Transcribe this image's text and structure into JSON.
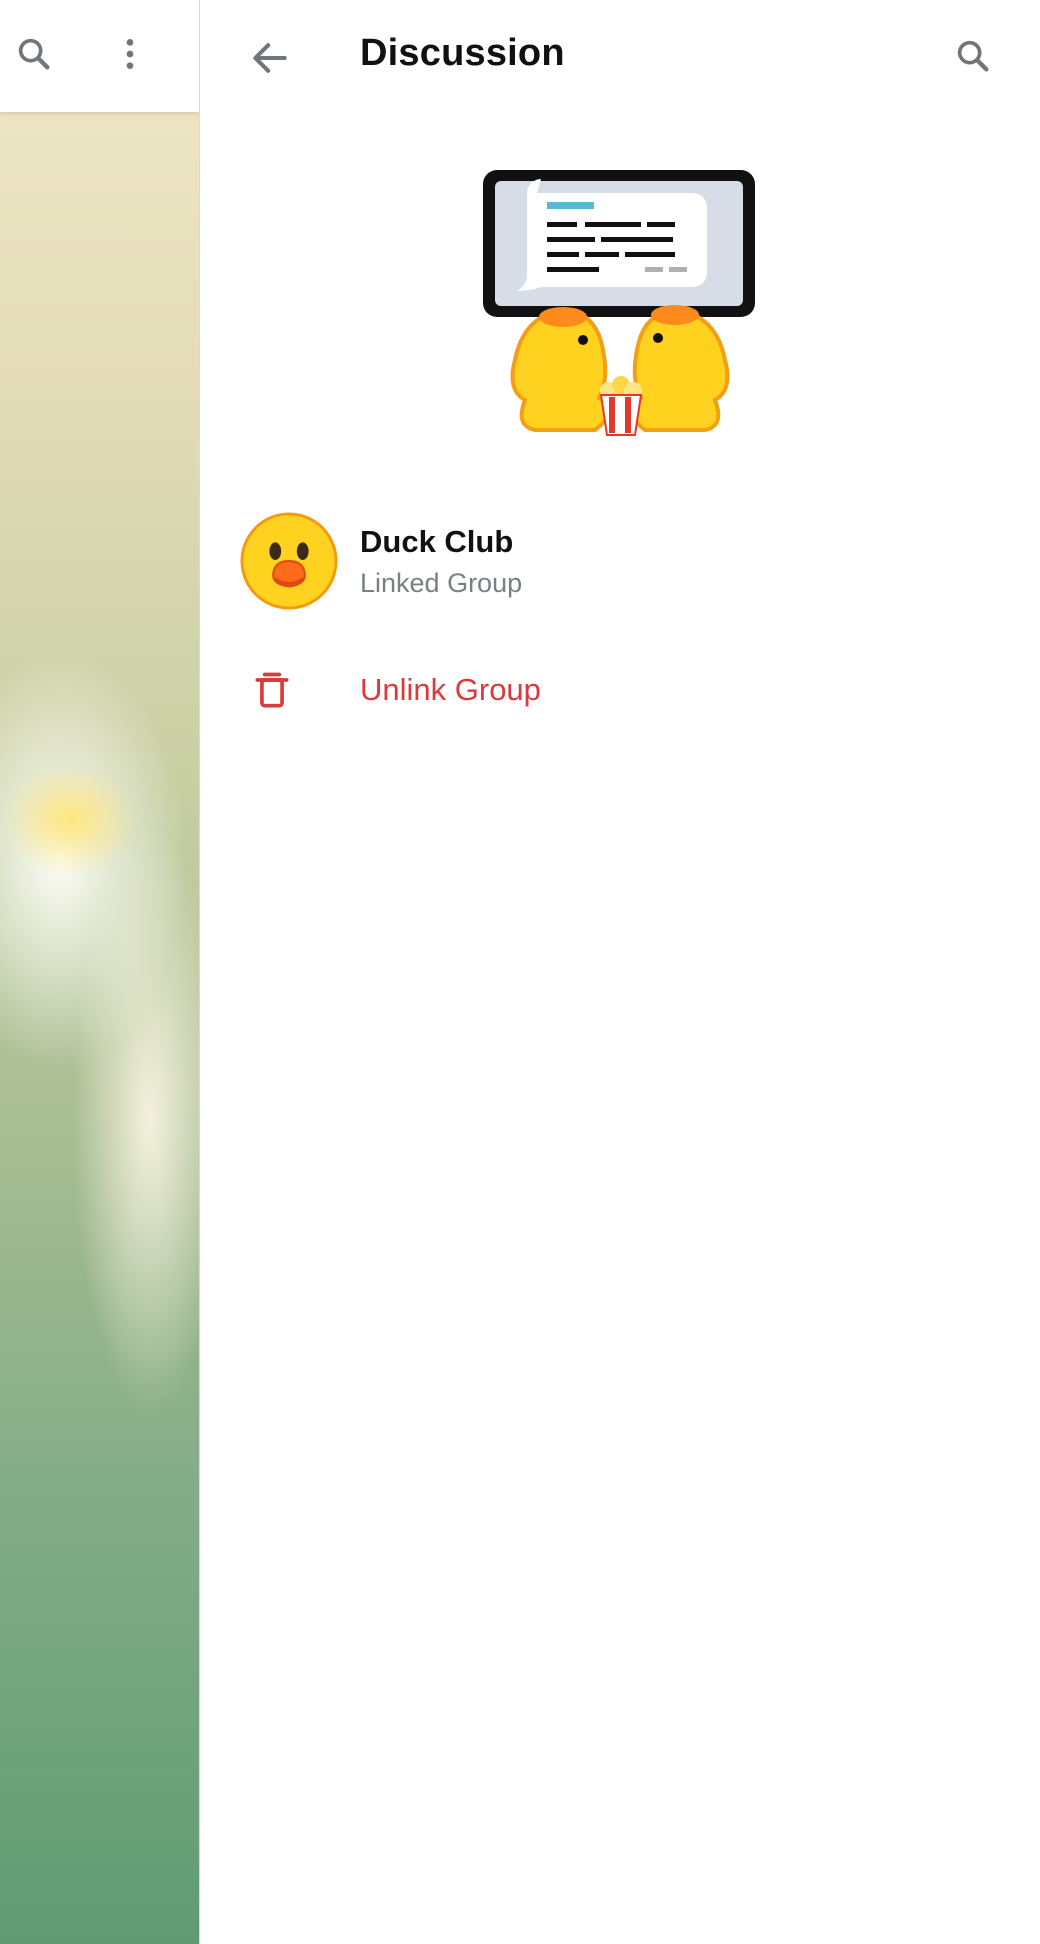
{
  "left_panel": {
    "icons": {
      "search": "search-icon",
      "more": "more-vert-icon"
    }
  },
  "header": {
    "title": "Discussion",
    "back_icon": "arrow-back-icon",
    "search_icon": "search-icon"
  },
  "illustration": "ducks-watching-tablet-sticker",
  "linked_group": {
    "name": "Duck Club",
    "subtitle": "Linked Group",
    "avatar": "duck-avatar"
  },
  "actions": {
    "unlink_label": "Unlink Group",
    "unlink_icon": "trash-icon"
  },
  "colors": {
    "destructive": "#d93a3a",
    "subtitle": "#7b7f84",
    "icon_gray": "#707579",
    "title": "#111111"
  }
}
